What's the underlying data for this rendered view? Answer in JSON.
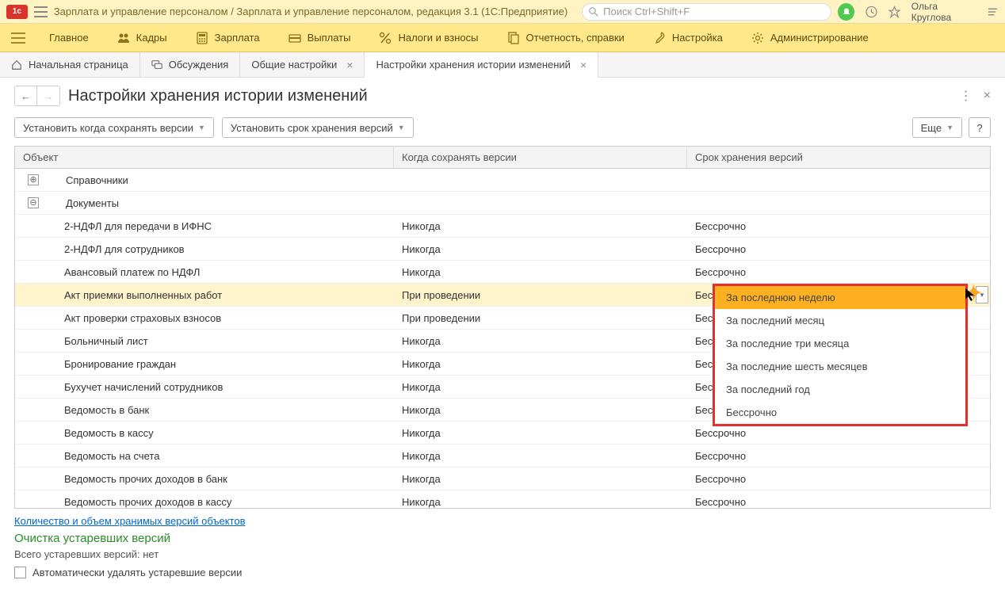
{
  "titlebar": {
    "app_title": "Зарплата и управление персоналом / Зарплата и управление персоналом, редакция 3.1  (1С:Предприятие)",
    "search_placeholder": "Поиск Ctrl+Shift+F",
    "user": "Ольга Круглова"
  },
  "mainmenu": {
    "items": [
      {
        "label": "Главное"
      },
      {
        "label": "Кадры"
      },
      {
        "label": "Зарплата"
      },
      {
        "label": "Выплаты"
      },
      {
        "label": "Налоги и взносы"
      },
      {
        "label": "Отчетность, справки"
      },
      {
        "label": "Настройка"
      },
      {
        "label": "Администрирование"
      }
    ]
  },
  "tabs": {
    "items": [
      {
        "label": "Начальная страница",
        "closable": false
      },
      {
        "label": "Обсуждения",
        "closable": false
      },
      {
        "label": "Общие настройки",
        "closable": true
      },
      {
        "label": "Настройки хранения истории изменений",
        "closable": true,
        "active": true
      }
    ]
  },
  "page": {
    "title": "Настройки хранения истории изменений"
  },
  "toolbar": {
    "set_when": "Установить когда сохранять версии",
    "set_term": "Установить срок хранения версий",
    "more": "Еще",
    "help": "?"
  },
  "table": {
    "headers": {
      "object": "Объект",
      "when": "Когда сохранять версии",
      "term": "Срок хранения версий"
    },
    "groups": [
      {
        "label": "Справочники",
        "expanded": false
      },
      {
        "label": "Документы",
        "expanded": true
      }
    ],
    "rows": [
      {
        "object": "2-НДФЛ для передачи в ИФНС",
        "when": "Никогда",
        "term": "Бессрочно"
      },
      {
        "object": "2-НДФЛ для сотрудников",
        "when": "Никогда",
        "term": "Бессрочно"
      },
      {
        "object": "Авансовый платеж по НДФЛ",
        "when": "Никогда",
        "term": "Бессрочно"
      },
      {
        "object": "Акт приемки выполненных работ",
        "when": "При проведении",
        "term": "Бессрочно",
        "selected": true
      },
      {
        "object": "Акт проверки страховых взносов",
        "when": "При проведении",
        "term": "Бессрочно"
      },
      {
        "object": "Больничный лист",
        "when": "Никогда",
        "term": "Бессрочно"
      },
      {
        "object": "Бронирование граждан",
        "when": "Никогда",
        "term": "Бессрочно"
      },
      {
        "object": "Бухучет начислений сотрудников",
        "when": "Никогда",
        "term": "Бессрочно"
      },
      {
        "object": "Ведомость в банк",
        "when": "Никогда",
        "term": "Бессрочно"
      },
      {
        "object": "Ведомость в кассу",
        "when": "Никогда",
        "term": "Бессрочно"
      },
      {
        "object": "Ведомость на счета",
        "when": "Никогда",
        "term": "Бессрочно"
      },
      {
        "object": "Ведомость прочих доходов в банк",
        "when": "Никогда",
        "term": "Бессрочно"
      },
      {
        "object": "Ведомость прочих доходов в кассу",
        "when": "Никогда",
        "term": "Бессрочно"
      }
    ]
  },
  "dropdown": {
    "items": [
      "За последнюю неделю",
      "За последний месяц",
      "За последние три месяца",
      "За последние шесть месяцев",
      "За последний год",
      "Бессрочно"
    ]
  },
  "footer": {
    "link": "Количество и объем хранимых версий объектов",
    "section": "Очистка устаревших версий",
    "total": "Всего устаревших версий: нет",
    "auto_delete": "Автоматически удалять устаревшие версии"
  }
}
